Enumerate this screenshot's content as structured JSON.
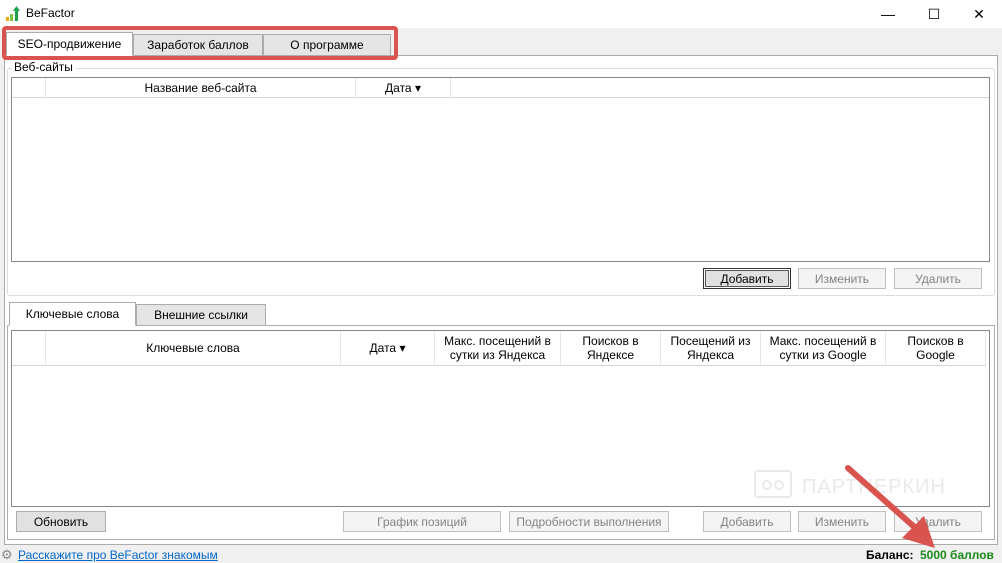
{
  "window": {
    "title": "BeFactor",
    "minimize": "—",
    "maximize": "☐",
    "close": "✕"
  },
  "main_tabs": [
    {
      "label": "SEO-продвижение",
      "active": true
    },
    {
      "label": "Заработок баллов"
    },
    {
      "label": "О программе"
    }
  ],
  "websites": {
    "group_label": "Веб-сайты",
    "columns": [
      "Название веб-сайта",
      "Дата ▾"
    ],
    "rows": [],
    "buttons": {
      "add": "Добавить",
      "edit": "Изменить",
      "delete": "Удалить"
    }
  },
  "sub_tabs": [
    {
      "label": "Ключевые слова",
      "active": true
    },
    {
      "label": "Внешние ссылки"
    }
  ],
  "keywords": {
    "columns": [
      "Ключевые слова",
      "Дата ▾",
      "Макс. посещений в сутки из Яндекса",
      "Поисков в Яндексе",
      "Посещений из Яндекса",
      "Макс. посещений в сутки из Google",
      "Поисков в Google"
    ],
    "rows": [],
    "buttons": {
      "refresh": "Обновить",
      "positions_chart": "График позиций",
      "details": "Подробности выполнения",
      "add": "Добавить",
      "edit": "Изменить",
      "delete": "Удалить"
    }
  },
  "footer": {
    "link": "Расскажите про BeFactor знакомым",
    "balance_label": "Баланс:",
    "balance_value": "5000 баллов"
  },
  "watermark": "ПАРТНЕРКИН",
  "colors": {
    "highlight": "#d9534f",
    "balance": "#1a8a1a",
    "link": "#0066cc"
  }
}
